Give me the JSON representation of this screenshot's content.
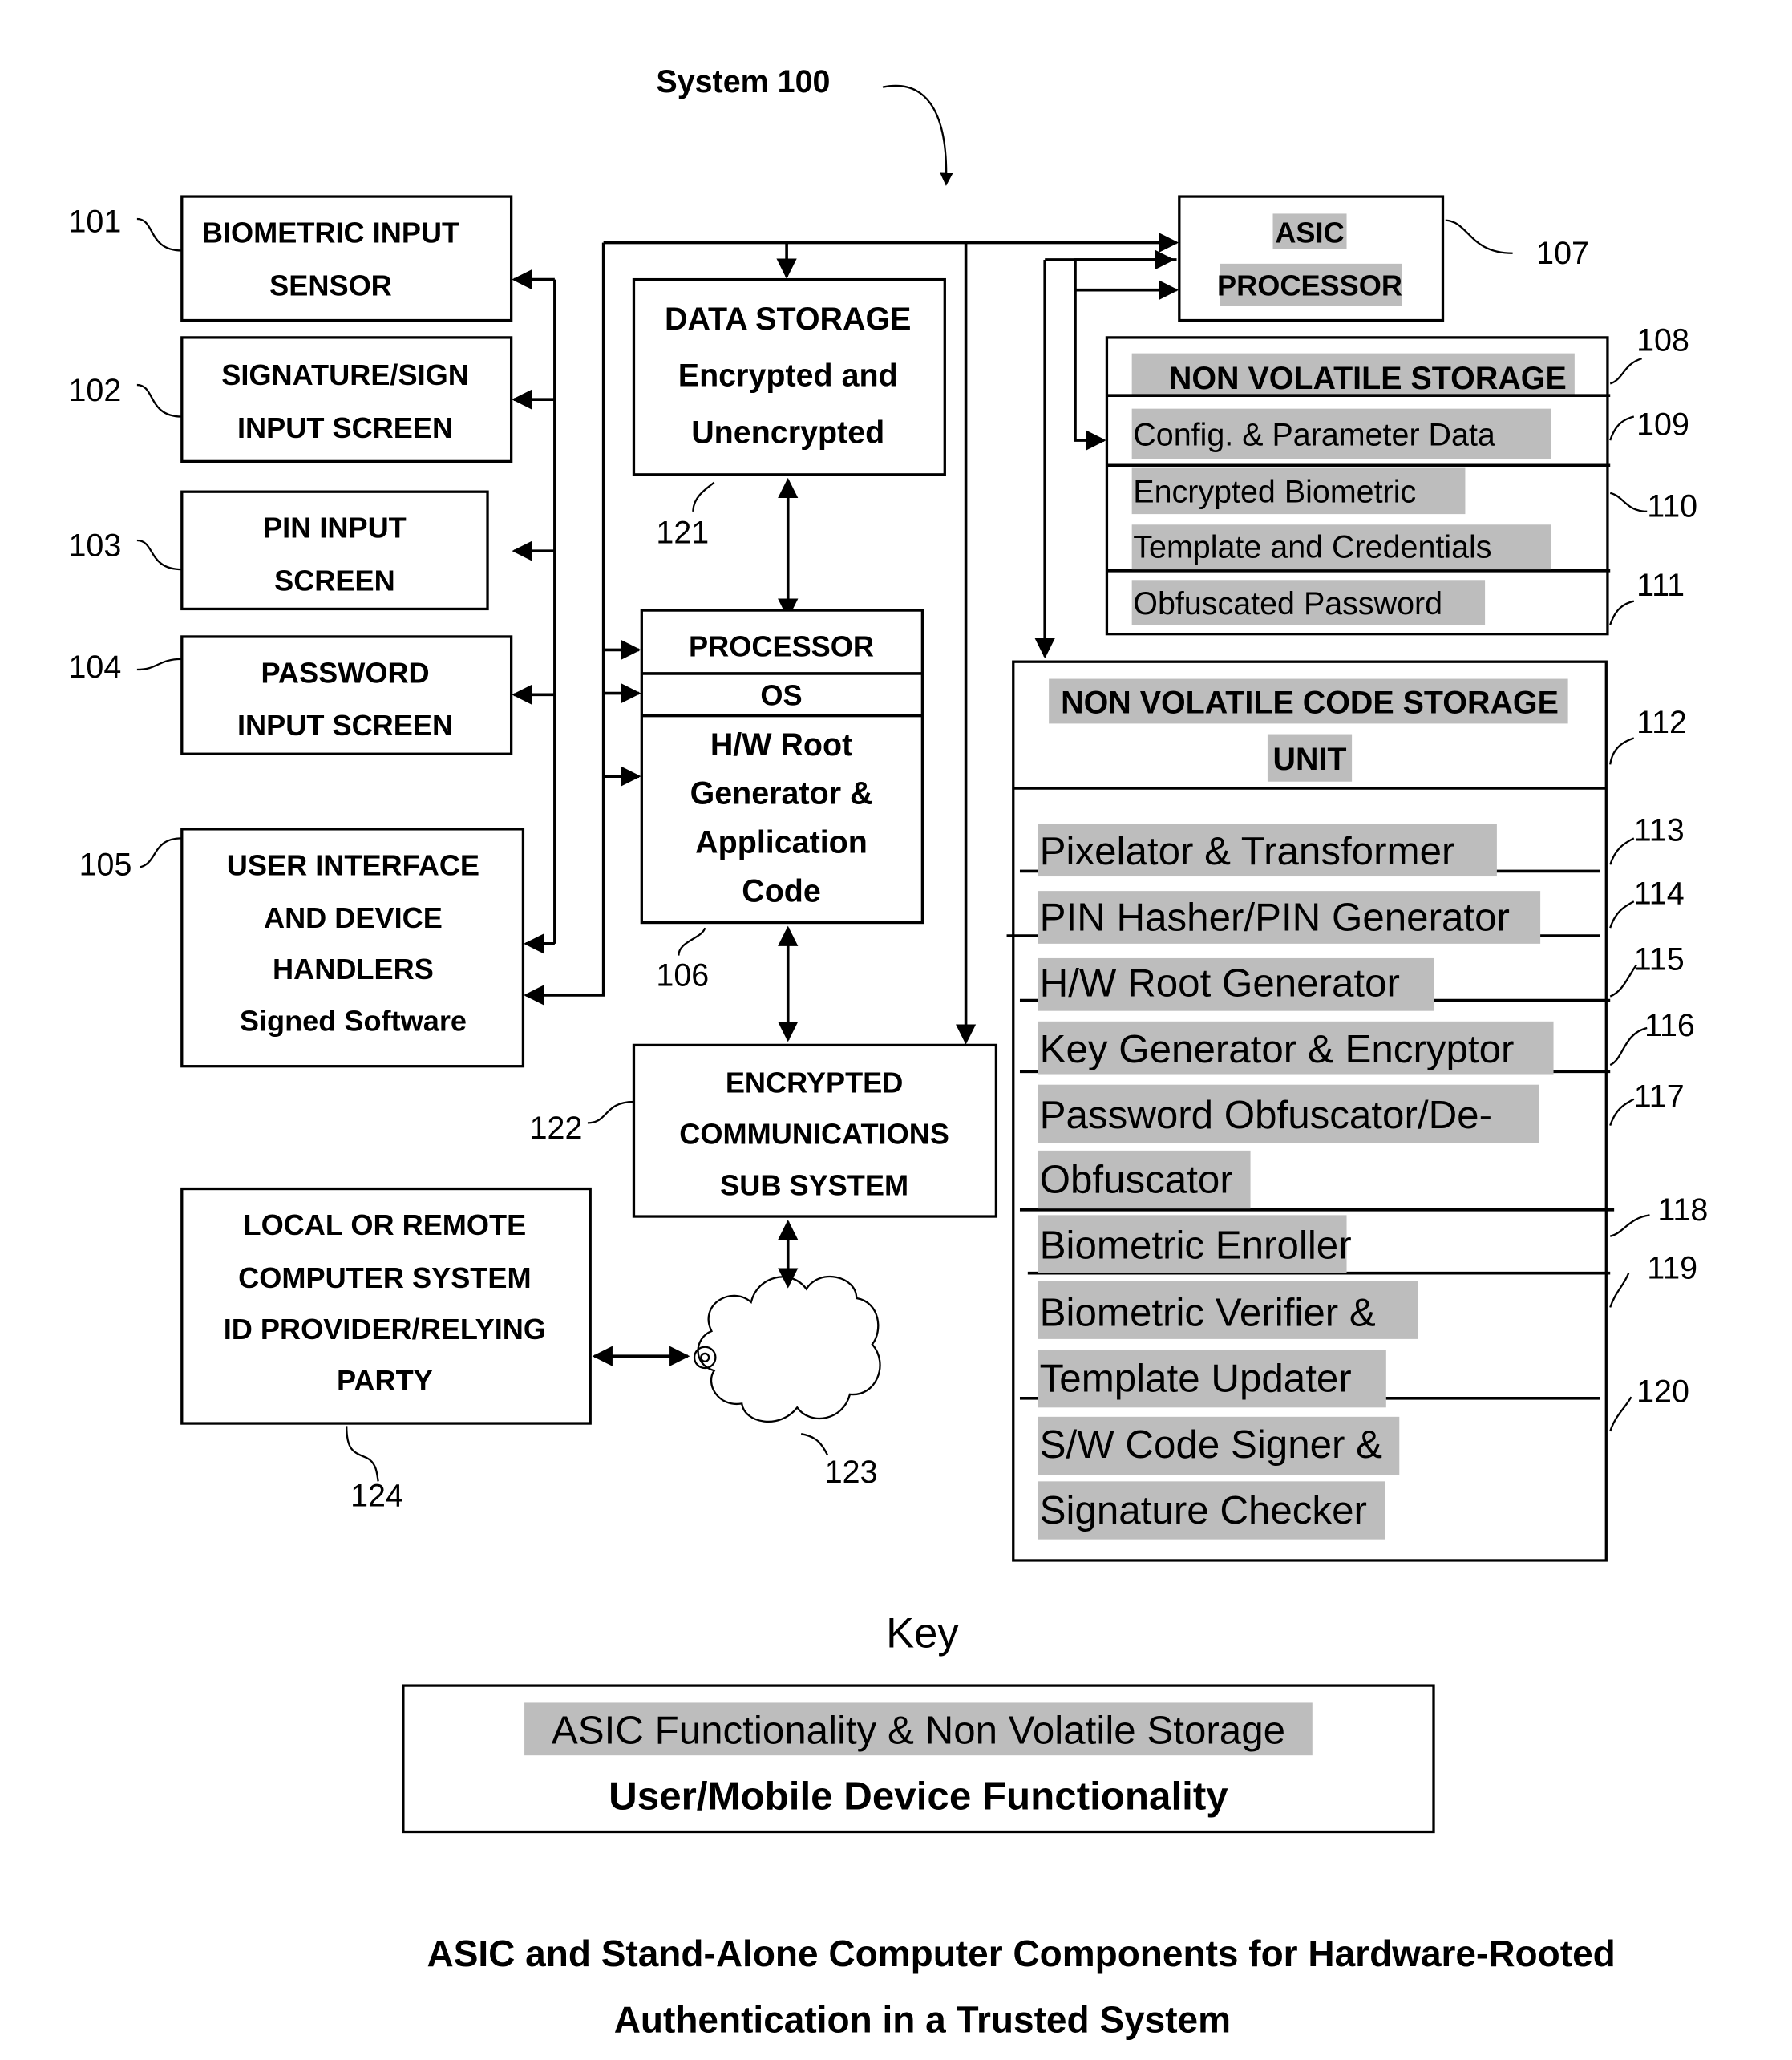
{
  "system_label": "System 100",
  "colors": {
    "asic_highlight": "#bdbdbd",
    "line": "#000000",
    "background": "#ffffff"
  },
  "components": {
    "biometric_sensor": {
      "ref": "101",
      "lines": [
        "BIOMETRIC INPUT",
        "SENSOR"
      ]
    },
    "signature_screen": {
      "ref": "102",
      "lines": [
        "SIGNATURE/SIGN",
        "INPUT SCREEN"
      ]
    },
    "pin_screen": {
      "ref": "103",
      "lines": [
        "PIN INPUT",
        "SCREEN"
      ]
    },
    "password_screen": {
      "ref": "104",
      "lines": [
        "PASSWORD",
        "INPUT SCREEN"
      ]
    },
    "ui_handlers": {
      "ref": "105",
      "lines": [
        "USER INTERFACE",
        "AND DEVICE",
        "HANDLERS",
        "Signed Software"
      ]
    },
    "processor": {
      "ref": "106",
      "header": "PROCESSOR",
      "os": "OS",
      "lines": [
        "H/W Root",
        "Generator &",
        "Application",
        "Code"
      ]
    },
    "asic_processor": {
      "ref": "107",
      "lines": [
        "ASIC",
        "PROCESSOR"
      ]
    },
    "non_volatile_storage": {
      "ref": "108",
      "title": "NON VOLATILE STORAGE",
      "rows": [
        {
          "ref": "109",
          "lines": [
            "Config. & Parameter Data"
          ]
        },
        {
          "ref": "110",
          "lines": [
            "Encrypted Biometric",
            "Template and Credentials"
          ]
        },
        {
          "ref": "111",
          "lines": [
            "Obfuscated Password"
          ]
        }
      ]
    },
    "code_storage": {
      "ref": "112",
      "title_lines": [
        "NON VOLATILE CODE STORAGE",
        "UNIT"
      ],
      "rows": [
        {
          "ref": "113",
          "lines": [
            "Pixelator & Transformer"
          ]
        },
        {
          "ref": "114",
          "lines": [
            "PIN Hasher/PIN Generator"
          ]
        },
        {
          "ref": "115",
          "lines": [
            "H/W Root Generator"
          ]
        },
        {
          "ref": "116",
          "lines": [
            "Key Generator & Encryptor"
          ]
        },
        {
          "ref": "117",
          "lines": [
            "Password  Obfuscator/De-",
            "Obfuscator"
          ]
        },
        {
          "ref": "118",
          "lines": [
            "Biometric Enroller"
          ]
        },
        {
          "ref": "119",
          "lines": [
            "Biometric Verifier &",
            "Template Updater"
          ]
        },
        {
          "ref": "120",
          "lines": [
            "S/W Code Signer &",
            "Signature Checker"
          ]
        }
      ]
    },
    "data_storage": {
      "ref": "121",
      "lines": [
        "DATA STORAGE",
        "Encrypted and",
        "Unencrypted"
      ]
    },
    "comm_subsystem": {
      "ref": "122",
      "lines": [
        "ENCRYPTED",
        "COMMUNICATIONS",
        "SUB SYSTEM"
      ]
    },
    "cloud": {
      "ref": "123"
    },
    "remote_system": {
      "ref": "124",
      "lines": [
        "LOCAL OR REMOTE",
        "COMPUTER SYSTEM",
        "ID PROVIDER/RELYING",
        "PARTY"
      ]
    }
  },
  "key": {
    "title": "Key",
    "asic_entry": "ASIC Functionality & Non Volatile Storage",
    "user_entry": "User/Mobile Device Functionality"
  },
  "caption": {
    "line1": "ASIC and Stand-Alone Computer Components for Hardware-Rooted",
    "line2": "Authentication in a Trusted System"
  }
}
